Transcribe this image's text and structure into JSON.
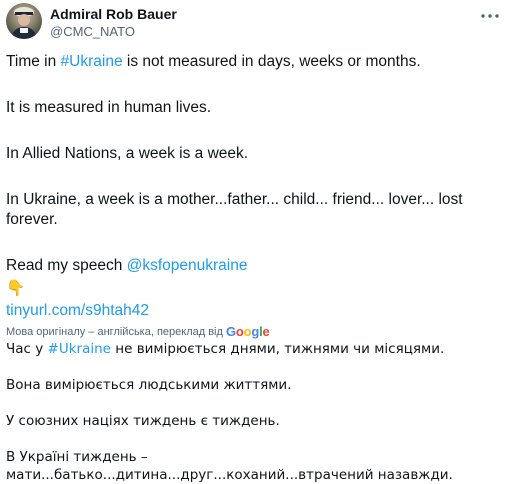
{
  "author": {
    "name": "Admiral Rob Bauer",
    "handle": "@CMC_NATO"
  },
  "menu_icon": "more-dots-icon",
  "tweet": {
    "line1_before": "Time in ",
    "line1_hashtag": "#Ukraine",
    "line1_after": " is not measured in days, weeks or months.",
    "line2": "It is measured in human lives.",
    "line3": "In Allied Nations, a week is a week.",
    "line4": "In Ukraine, a week is a mother...father... child... friend... lover...  lost forever.",
    "line5_before": "Read my speech ",
    "line5_mention": "@ksfopenukraine",
    "emoji": "👇",
    "url": "tinyurl.com/s9htah42"
  },
  "translation": {
    "note": "Мова оригіналу – англійська, переклад від",
    "provider": "Google",
    "line1_before": "Час у ",
    "line1_hashtag": "#Ukraine",
    "line1_after": " не вимірюється днями, тижнями чи місяцями.",
    "line2": "Вона вимірюється людськими життями.",
    "line3": "У союзних націях тиждень є тиждень.",
    "line4": "В Україні тиждень – мати...батько...дитина...друг...коханий...втрачений назавжди."
  },
  "colors": {
    "link": "#1d9bf0",
    "text": "#0f1419",
    "secondary": "#536471"
  }
}
